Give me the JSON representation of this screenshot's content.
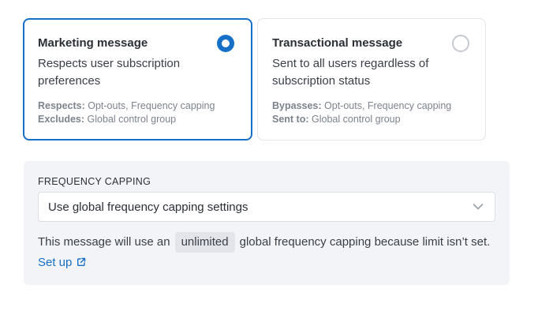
{
  "marketing": {
    "title": "Marketing message",
    "description": "Respects user subscription preferences",
    "meta1_label": "Respects:",
    "meta1_value": "Opt-outs, Frequency capping",
    "meta2_label": "Excludes:",
    "meta2_value": "Global control group",
    "selected": true
  },
  "transactional": {
    "title": "Transactional message",
    "description": "Sent to all users regardless of subscription status",
    "meta1_label": "Bypasses:",
    "meta1_value": "Opt-outs, Frequency capping",
    "meta2_label": "Sent to:",
    "meta2_value": "Global control group",
    "selected": false
  },
  "frequency": {
    "label": "FREQUENCY CAPPING",
    "select_value": "Use global frequency capping settings",
    "note_before": "This message will use an",
    "pill": "unlimited",
    "note_after": "global frequency capping because limit isn’t set.",
    "link": "Set up"
  },
  "colors": {
    "accent": "#1670c7",
    "panel_bg": "#f3f4f8",
    "muted_text": "#7d838c"
  },
  "icons": {
    "radio_selected": "radio-selected-icon",
    "radio_unselected": "radio-unselected-icon",
    "dropdown": "chevron-down-icon",
    "external": "external-link-icon"
  }
}
